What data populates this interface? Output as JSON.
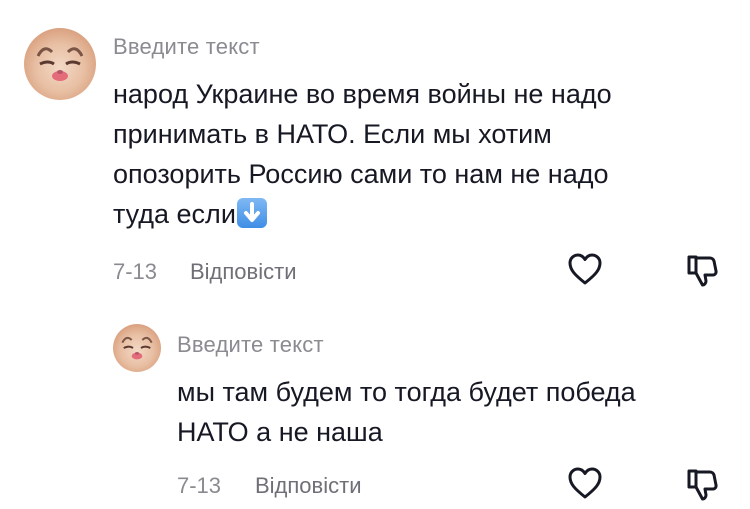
{
  "comments": [
    {
      "username": "Введите текст",
      "text": "народ Украине во время войны не надо\nпринимать в НАТО. Если мы хотим\nопозорить Россию сами то нам не надо\nтуда если",
      "emoji_icon": "down-arrow-emoji-icon",
      "date": "7-13",
      "reply_label": "Відповісти"
    },
    {
      "username": "Введите текст",
      "text": "мы там будем то тогда будет победа\nНАТО а не наша",
      "date": "7-13",
      "reply_label": "Відповісти"
    }
  ],
  "icons": {
    "like": "heart-outline-icon",
    "dislike": "thumbs-down-outline-icon"
  }
}
